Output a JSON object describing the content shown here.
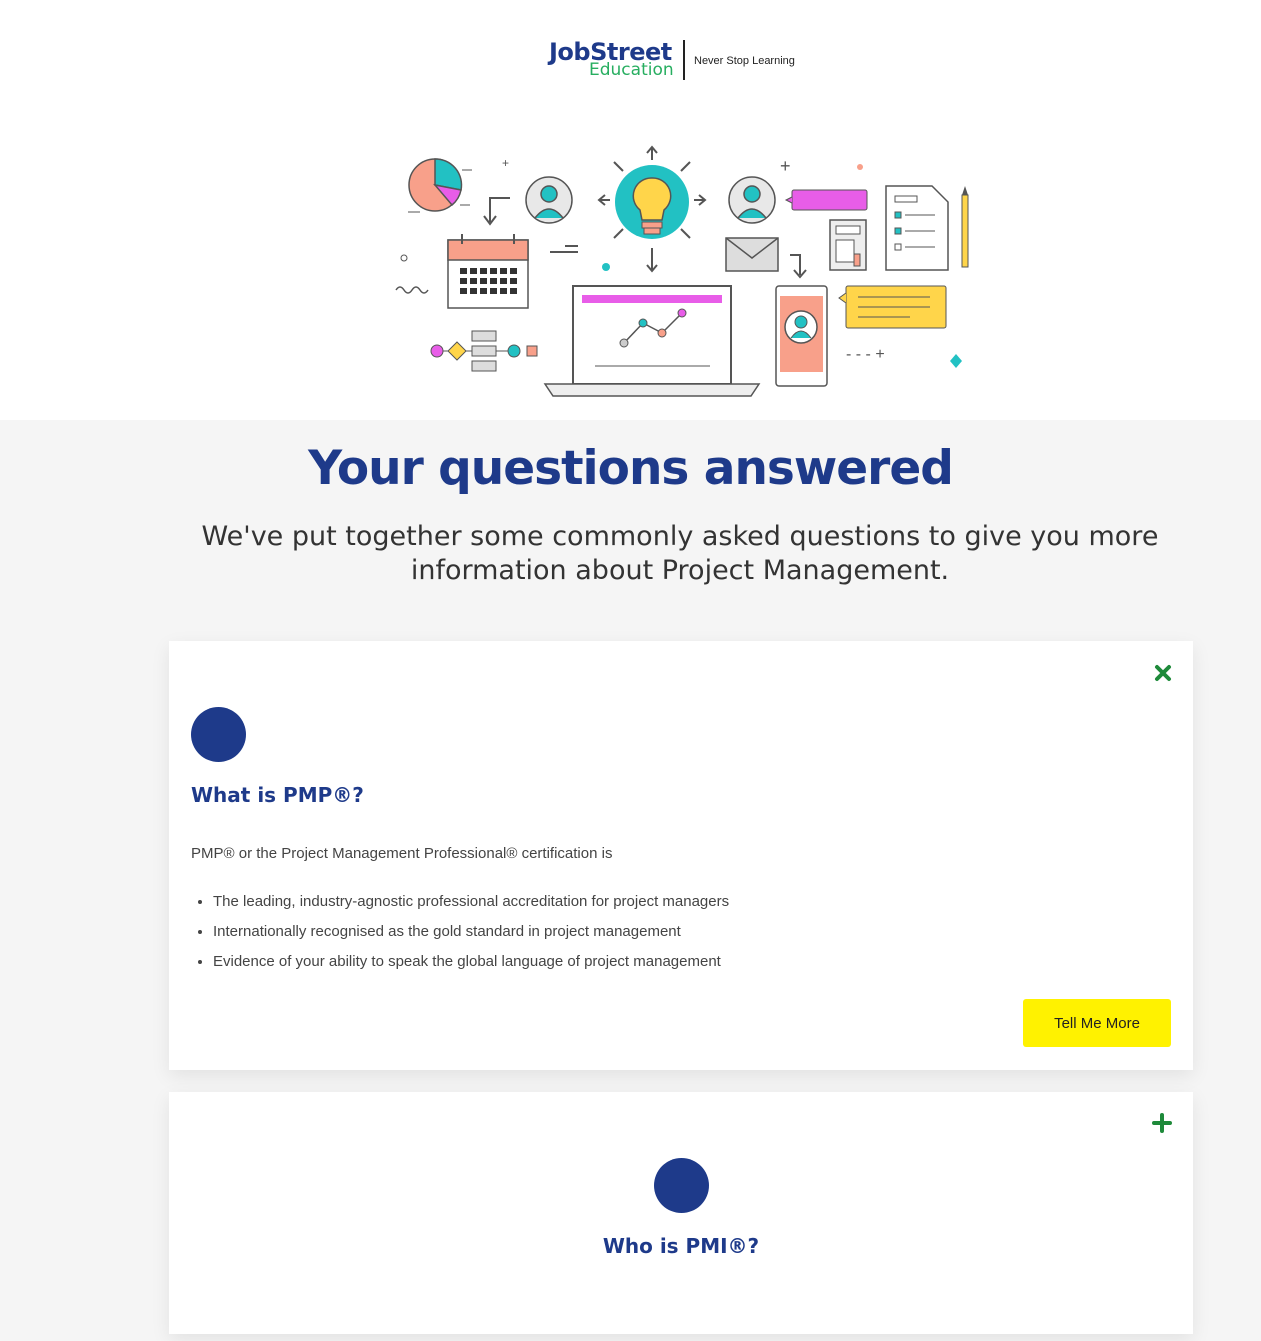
{
  "header": {
    "logo": {
      "brand": "JobStreet",
      "sub": "Education",
      "tagline": "Never Stop Learning"
    }
  },
  "hero": {
    "icon": "project-management-illustration"
  },
  "faq": {
    "title": "Your questions answered",
    "subtitle": "We've put together some commonly asked questions to give you more information about Project Management.",
    "items": [
      {
        "question": "What is PMP®?",
        "expanded": true,
        "toggle_icon": "close-icon",
        "intro": "PMP® or the Project Management Professional® certification is",
        "bullets": [
          "The leading, industry-agnostic professional accreditation for project managers",
          "Internationally recognised as the gold standard in project management",
          "Evidence of your ability to speak the global language of project management"
        ],
        "button": "Tell Me More"
      },
      {
        "question": "Who is PMI®?",
        "expanded": false,
        "toggle_icon": "plus-icon"
      }
    ]
  },
  "colors": {
    "brand_blue": "#1e3a8a",
    "brand_green": "#27ae60",
    "toggle_green": "#1e8a3a",
    "button_yellow": "#fff200"
  }
}
